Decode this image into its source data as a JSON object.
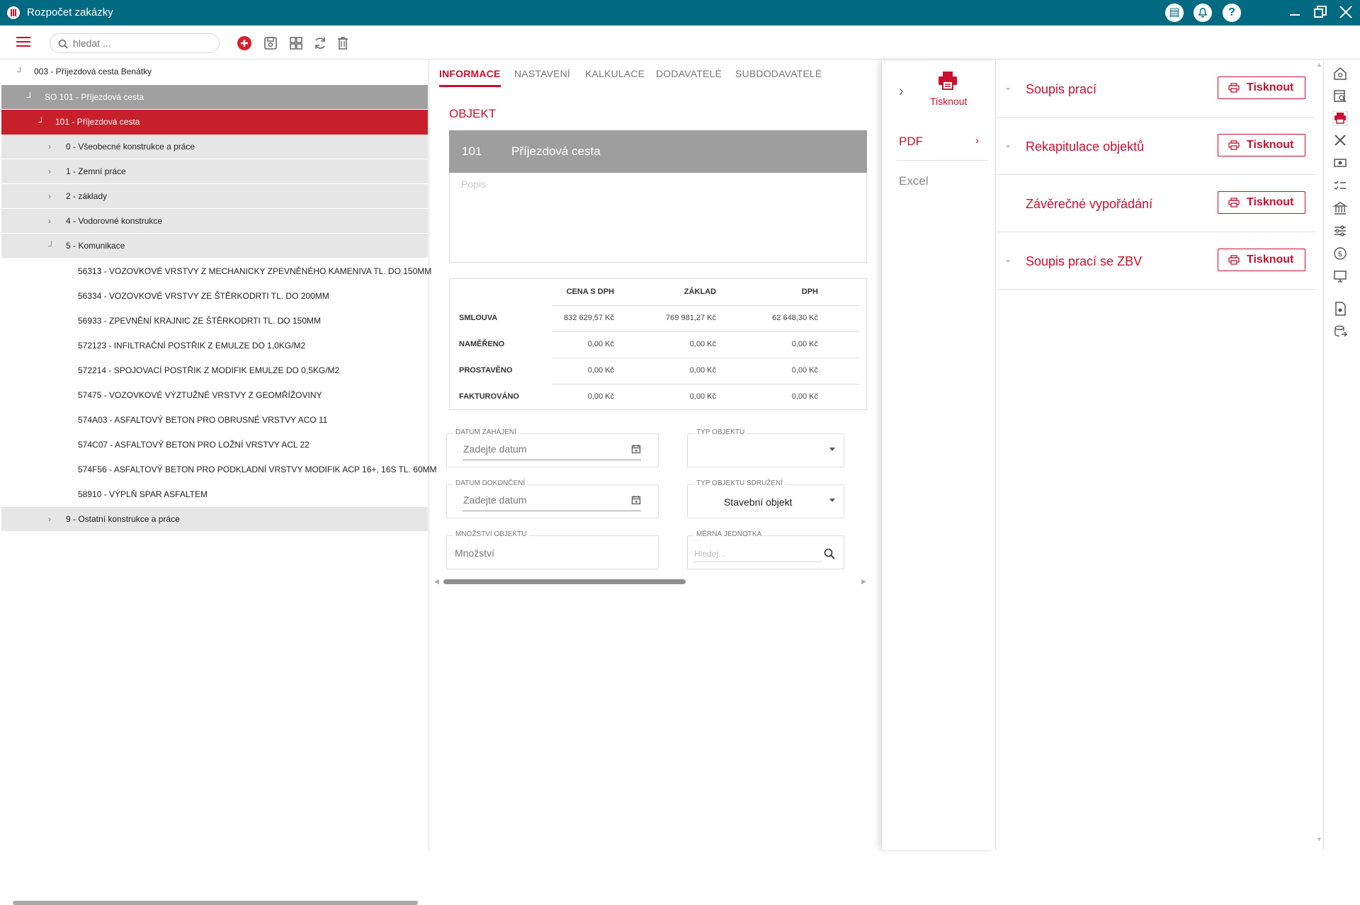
{
  "app": {
    "title": "Rozpočet zakázky"
  },
  "toolbar": {
    "search_placeholder": "hledat ..."
  },
  "tree": {
    "root": "003 - Příjezdová cesta Benátky",
    "so": "SO 101 - Příjezdová cesta",
    "obj": "101 - Příjezdová cesta",
    "groups": [
      "0 - Všeobecné konstrukce a práce",
      "1 - Zemní práce",
      "2 - základy",
      "4 - Vodorovné konstrukce",
      "5 - Komunikace"
    ],
    "items": [
      "56313 - VOZOVKOVÉ VRSTVY Z MECHANICKY ZPEVNĚNÉHO KAMENIVA TL. DO 150MM",
      "56334 - VOZOVKOVÉ VRSTVY ZE ŠTĚRKODRTI TL. DO 200MM",
      "56933 - ZPEVNĚNÍ KRAJNIC ZE ŠTĚRKODRTI TL. DO 150MM",
      "572123 - INFILTRAČNÍ POSTŘIK Z EMULZE DO 1,0KG/M2",
      "572214 - SPOJOVACÍ POSTŘIK Z MODIFIK EMULZE DO 0,5KG/M2",
      "57475 - VOZOVKOVÉ VÝZTUŽNÉ VRSTVY Z GEOMŘÍŽOVINY",
      "574A03 - ASFALTOVÝ BETON PRO OBRUSNÉ VRSTVY ACO 11",
      "574C07 - ASFALTOVÝ BETON PRO LOŽNÍ VRSTVY ACL 22",
      "574F56 - ASFALTOVÝ BETON PRO PODKLADNÍ VRSTVY MODIFIK ACP 16+, 16S TL. 60MM",
      "58910 - VÝPLŇ SPAR ASFALTEM"
    ],
    "last_group": "9 - Ostatní konstrukce a práce"
  },
  "tabs": [
    "INFORMACE",
    "NASTAVENÍ",
    "KALKULACE",
    "DODAVATELÉ",
    "SUBDODAVATELÉ"
  ],
  "objekt": {
    "heading": "OBJEKT",
    "number": "101",
    "name": "Příjezdová cesta",
    "popis_placeholder": "Popis"
  },
  "summary": {
    "headers": [
      "CENA S DPH",
      "ZÁKLAD",
      "DPH"
    ],
    "rows": [
      {
        "label": "SMLOUVA",
        "values": [
          "832 629,57 Kč",
          "769 981,27 Kč",
          "62 648,30 Kč"
        ]
      },
      {
        "label": "NAMĚŘENO",
        "values": [
          "0,00 Kč",
          "0,00 Kč",
          "0,00 Kč"
        ]
      },
      {
        "label": "PROSTAVĚNO",
        "values": [
          "0,00 Kč",
          "0,00 Kč",
          "0,00 Kč"
        ]
      },
      {
        "label": "FAKTUROVÁNO",
        "values": [
          "0,00 Kč",
          "0,00 Kč",
          "0,00 Kč"
        ]
      }
    ]
  },
  "form": {
    "datum_zahajeni": {
      "label": "DATUM ZAHÁJENÍ",
      "placeholder": "Zadejte datum"
    },
    "datum_dokonceni": {
      "label": "DATUM DOKONČENÍ",
      "placeholder": "Zadejte datum"
    },
    "typ_objektu": {
      "label": "TYP OBJEKTU",
      "value": ""
    },
    "typ_objektu_sdruzeni": {
      "label": "TYP OBJEKTU SDRUŽENÍ",
      "value": "Stavební objekt"
    },
    "mnozstvi": {
      "label": "MNOŽSTVÍ OBJEKTU",
      "placeholder": "Množství"
    },
    "merna_jednotka": {
      "label": "MĚRNÁ JEDNOTKA",
      "placeholder": "Hledej..."
    }
  },
  "print_menu": {
    "print_label": "Tisknout",
    "pdf": "PDF",
    "excel": "Excel"
  },
  "reports": [
    {
      "title": "Soupis prací",
      "button": "Tisknout"
    },
    {
      "title": "Rekapitulace objektů",
      "button": "Tisknout"
    },
    {
      "title": "Závěrečné vypořádání",
      "button": "Tisknout"
    },
    {
      "title": "Soupis prací se ZBV",
      "button": "Tisknout"
    }
  ],
  "colors": {
    "brand": "#c8102e",
    "titlebar": "#006a82"
  }
}
